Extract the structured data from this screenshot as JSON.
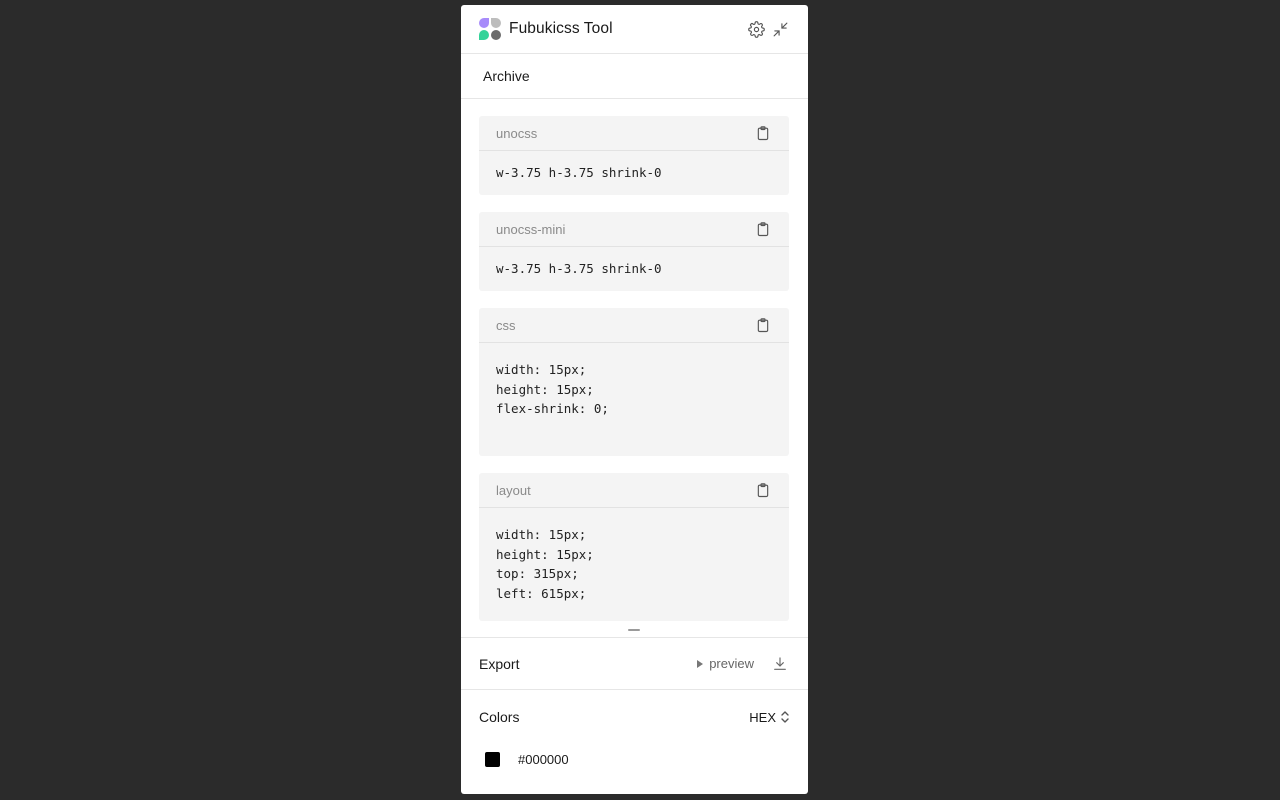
{
  "app": {
    "title": "Fubukicss Tool"
  },
  "tabs": [
    {
      "label": "Archive"
    }
  ],
  "cards": [
    {
      "title": "unocss",
      "code": "w-3.75 h-3.75 shrink-0"
    },
    {
      "title": "unocss-mini",
      "code": "w-3.75 h-3.75 shrink-0"
    },
    {
      "title": "css",
      "code": "width: 15px;\nheight: 15px;\nflex-shrink: 0;"
    },
    {
      "title": "layout",
      "code": "width: 15px;\nheight: 15px;\ntop: 315px;\nleft: 615px;"
    }
  ],
  "export": {
    "title": "Export",
    "preview_label": "preview"
  },
  "colors": {
    "title": "Colors",
    "format": "HEX",
    "items": [
      {
        "value": "#000000",
        "swatch": "#000000"
      }
    ]
  },
  "icons": {
    "settings": "gear-icon",
    "collapse": "collapse-icon",
    "copy": "clipboard-icon",
    "download": "download-icon",
    "sort": "chevron-up-down-icon"
  }
}
